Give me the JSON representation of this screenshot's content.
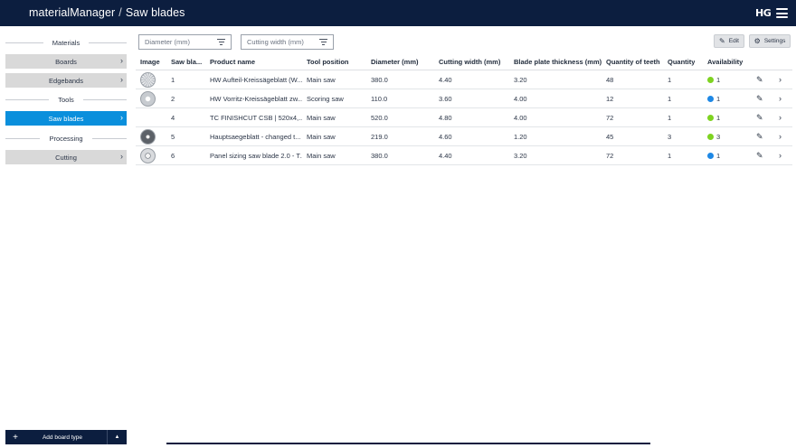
{
  "header": {
    "app": "materialManager",
    "separator": "/",
    "page": "Saw blades",
    "logo": "HG"
  },
  "sidebar": {
    "sections": [
      {
        "title": "Materials",
        "items": [
          {
            "label": "Boards"
          },
          {
            "label": "Edgebands"
          }
        ]
      },
      {
        "title": "Tools",
        "items": [
          {
            "label": "Saw blades",
            "active": true
          }
        ]
      },
      {
        "title": "Processing",
        "items": [
          {
            "label": "Cutting"
          }
        ]
      }
    ],
    "add_button": "Add board type"
  },
  "filters": {
    "diameter_placeholder": "Diameter (mm)",
    "cutting_width_placeholder": "Cutting width (mm)"
  },
  "toolbar": {
    "edit_label": "Edit",
    "settings_label": "Settings"
  },
  "table": {
    "columns": {
      "image": "Image",
      "saw_blade": "Saw bla...",
      "product_name": "Product name",
      "tool_position": "Tool position",
      "diameter": "Diameter (mm)",
      "cutting_width": "Cutting width (mm)",
      "blade_plate_thickness": "Blade plate thickness (mm)",
      "quantity_of_teeth": "Quantity of teeth",
      "quantity": "Quantity",
      "availability": "Availability"
    },
    "rows": [
      {
        "image": "striped",
        "saw_blade": "1",
        "product_name": "HW Aufteil-Kreissägeblatt (W...",
        "tool_position": "Main saw",
        "diameter": "380.0",
        "cutting_width": "4.40",
        "blade_plate_thickness": "3.20",
        "quantity_of_teeth": "48",
        "quantity": "1",
        "availability": "1",
        "availability_color": "#7ed321"
      },
      {
        "image": "light",
        "saw_blade": "2",
        "product_name": "HW Vorritz-Kreissägeblatt zw...",
        "tool_position": "Scoring saw",
        "diameter": "110.0",
        "cutting_width": "3.60",
        "blade_plate_thickness": "4.00",
        "quantity_of_teeth": "12",
        "quantity": "1",
        "availability": "1",
        "availability_color": "#1e88e5"
      },
      {
        "image": "none",
        "saw_blade": "4",
        "product_name": "TC FINISHCUT CSB | 520x4,...",
        "tool_position": "Main saw",
        "diameter": "520.0",
        "cutting_width": "4.80",
        "blade_plate_thickness": "4.00",
        "quantity_of_teeth": "72",
        "quantity": "1",
        "availability": "1",
        "availability_color": "#7ed321"
      },
      {
        "image": "dark",
        "saw_blade": "5",
        "product_name": "Hauptsaegeblatt - changed t...",
        "tool_position": "Main saw",
        "diameter": "219.0",
        "cutting_width": "4.60",
        "blade_plate_thickness": "1.20",
        "quantity_of_teeth": "45",
        "quantity": "3",
        "availability": "3",
        "availability_color": "#7ed321"
      },
      {
        "image": "plain",
        "saw_blade": "6",
        "product_name": "Panel sizing saw blade 2.0 - T...",
        "tool_position": "Main saw",
        "diameter": "380.0",
        "cutting_width": "4.40",
        "blade_plate_thickness": "3.20",
        "quantity_of_teeth": "72",
        "quantity": "1",
        "availability": "1",
        "availability_color": "#1e88e5"
      }
    ]
  }
}
